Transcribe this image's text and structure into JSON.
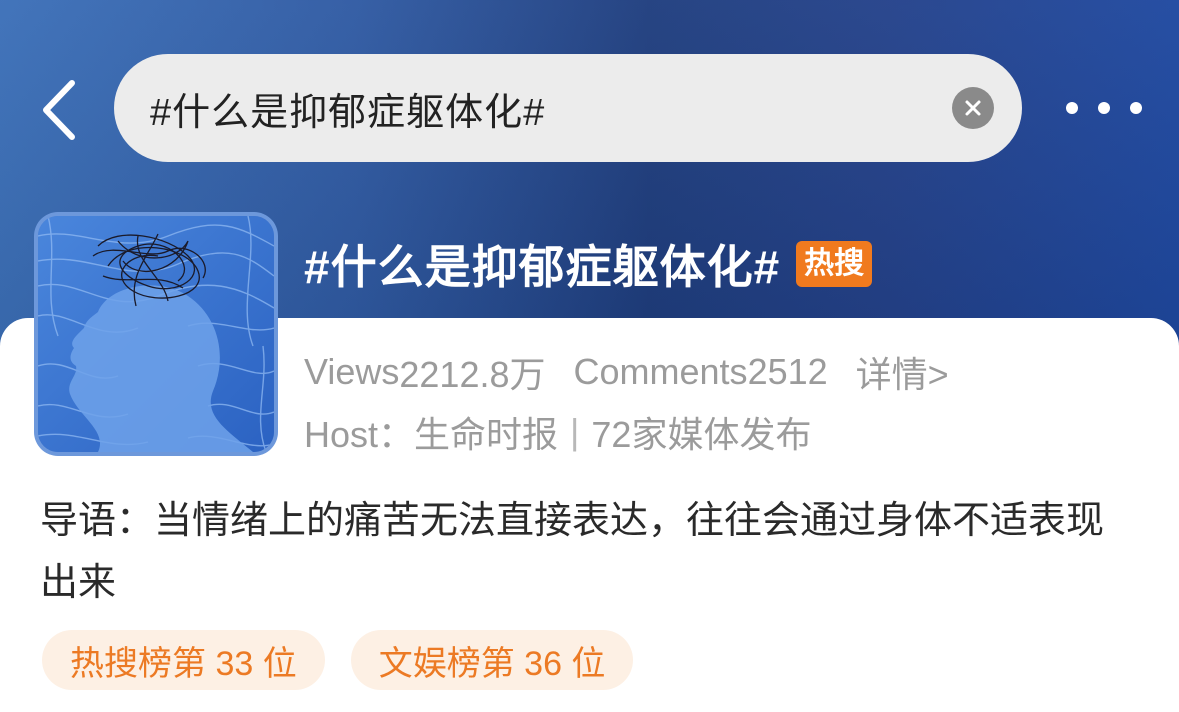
{
  "header": {
    "search_value": "#什么是抑郁症躯体化#",
    "back_icon": "chevron-left-icon",
    "clear_icon": "close-circle-icon",
    "more_icon": "more-horizontal-icon"
  },
  "topic": {
    "title": "#什么是抑郁症躯体化#",
    "badge": "热搜",
    "cover_image": "depressed-woman-silhouette-scribble-illustration",
    "views_label": "Views",
    "views_value": "2212.8万",
    "comments_label": "Comments",
    "comments_value": "2512",
    "detail_link": "详情>",
    "host_label": "Host：",
    "host_value": "生命时报",
    "separator": "|",
    "media_count": "72家媒体发布"
  },
  "intro": {
    "text": "导语：当情绪上的痛苦无法直接表达，往往会通过身体不适表现出来"
  },
  "tags": [
    {
      "label": "热搜榜第 33 位"
    },
    {
      "label": "文娱榜第 36 位"
    }
  ],
  "colors": {
    "header_gradient_start": "#3b6fb8",
    "header_gradient_end": "#1e48a0",
    "hot_badge": "#f07a1e",
    "tag_text": "#ec7a24",
    "tag_bg": "#fdf0e4",
    "meta_text": "#9b9b9b"
  }
}
